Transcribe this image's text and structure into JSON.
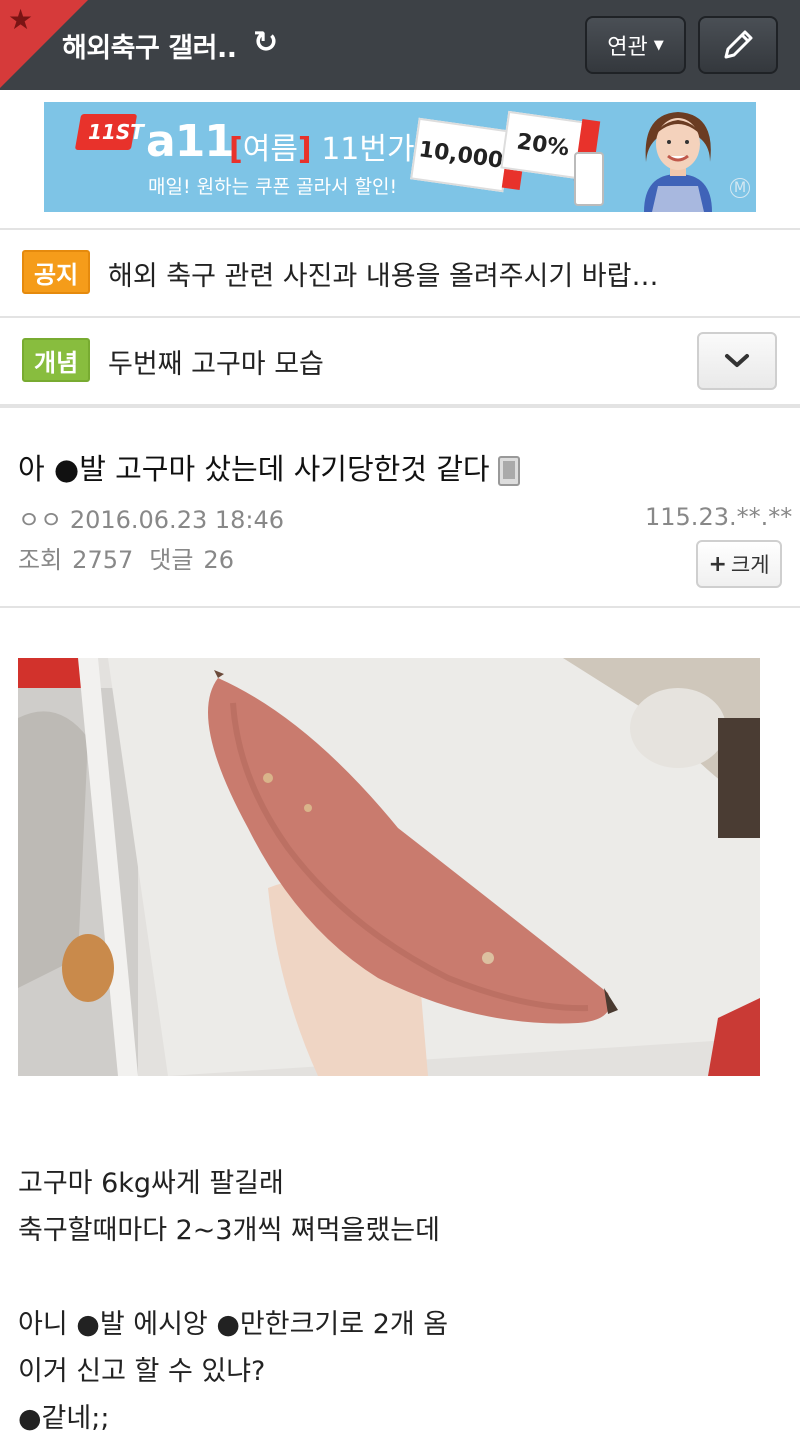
{
  "header": {
    "gallery_title": "해외축구 갤러..",
    "related_label": "연관",
    "related_caret": "▼",
    "refresh_glyph": "↻",
    "star_glyph": "★"
  },
  "ad": {
    "logo": "11ST",
    "brand": "a11",
    "season_open": "[",
    "season": "여름",
    "season_close": "]",
    "season_suffix": "11번가",
    "subtitle": "매일! 원하는 쿠폰 골라서 할인!",
    "coupon_amount": "10,000",
    "coupon_percent": "20%",
    "badge": "M"
  },
  "notice": {
    "badge": "공지",
    "text": "해외 축구 관련 사진과 내용을 올려주시기 바랍…"
  },
  "concept": {
    "badge": "개념",
    "text": "두번째 고구마 모습"
  },
  "post": {
    "title": "아 ●발 고구마 샀는데 사기당한것 같다",
    "author": "ㅇㅇ",
    "date": "2016.06.23 18:46",
    "ip": "115.23.**.**",
    "views_label": "조회",
    "views": "2757",
    "comments_label": "댓글",
    "comments": "26",
    "bigger_label": "크게",
    "bigger_plus": "+",
    "body": {
      "line1": "고구마 6kg싸게 팔길래",
      "line2": "축구할때마다 2~3개씩 쪄먹을랬는데",
      "line3": "아니 ●발 에시앙 ●만한크기로 2개 옴",
      "line4": "이거 신고 할 수 있냐?",
      "line5": "●같네;;"
    }
  },
  "colors": {
    "header_bg": "#3d4146",
    "star_corner": "#d63a3a",
    "notice_badge": "#f59c1a",
    "concept_badge": "#88bd3e",
    "ad_bg": "#7ec4e6"
  }
}
